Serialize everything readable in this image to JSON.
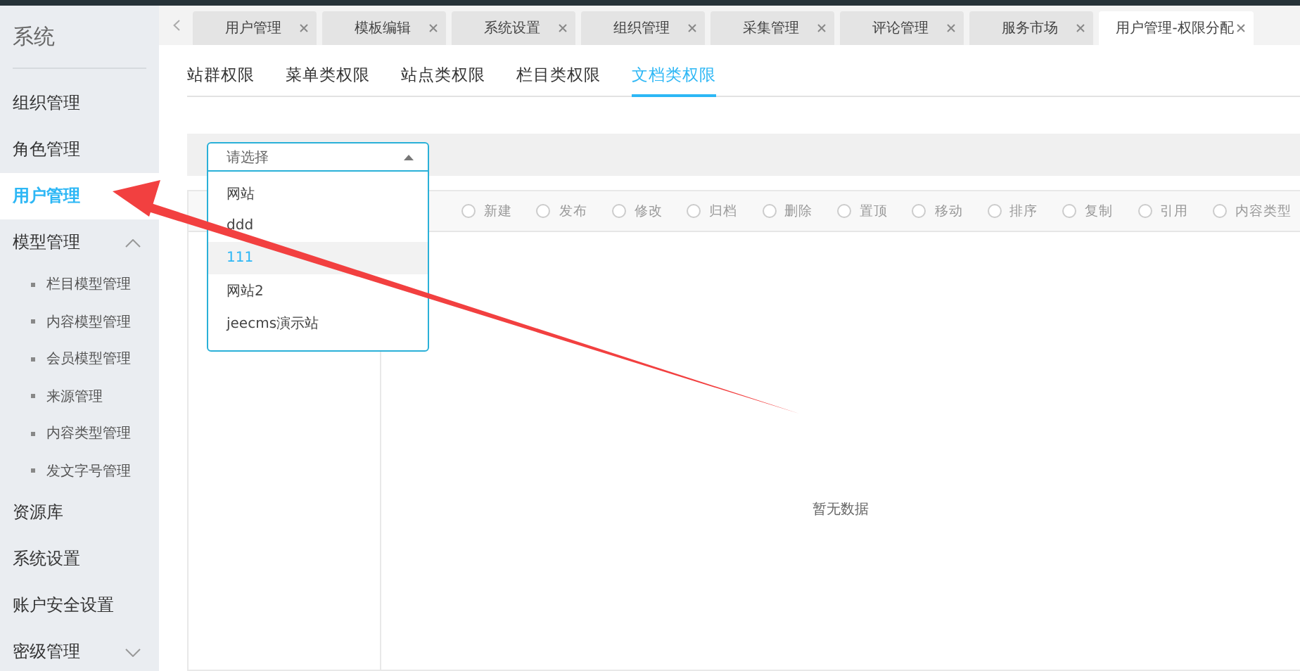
{
  "sidebar": {
    "title": "系统",
    "items": [
      {
        "label": "组织管理",
        "selected": false
      },
      {
        "label": "角色管理",
        "selected": false
      },
      {
        "label": "用户管理",
        "selected": true
      },
      {
        "label": "模型管理",
        "selected": false,
        "expanded": true,
        "children": [
          {
            "label": "栏目模型管理"
          },
          {
            "label": "内容模型管理"
          },
          {
            "label": "会员模型管理"
          },
          {
            "label": "来源管理"
          },
          {
            "label": "内容类型管理"
          },
          {
            "label": "发文字号管理"
          }
        ]
      },
      {
        "label": "资源库",
        "selected": false
      },
      {
        "label": "系统设置",
        "selected": false
      },
      {
        "label": "账户安全设置",
        "selected": false
      },
      {
        "label": "密级管理",
        "selected": false,
        "expanded": false
      }
    ]
  },
  "tabs": [
    {
      "label": "用户管理",
      "selected": false
    },
    {
      "label": "模板编辑",
      "selected": false
    },
    {
      "label": "系统设置",
      "selected": false
    },
    {
      "label": "组织管理",
      "selected": false
    },
    {
      "label": "采集管理",
      "selected": false
    },
    {
      "label": "评论管理",
      "selected": false
    },
    {
      "label": "服务市场",
      "selected": false
    },
    {
      "label": "用户管理-权限分配",
      "selected": true
    }
  ],
  "sub_tabs": [
    {
      "label": "站群权限",
      "selected": false
    },
    {
      "label": "菜单类权限",
      "selected": false
    },
    {
      "label": "站点类权限",
      "selected": false
    },
    {
      "label": "栏目类权限",
      "selected": false
    },
    {
      "label": "文档类权限",
      "selected": true
    }
  ],
  "site_select": {
    "placeholder": "请选择",
    "expanded": true,
    "options": [
      {
        "label": "网站",
        "selected": false
      },
      {
        "label": "ddd",
        "selected": false
      },
      {
        "label": "111",
        "selected": true
      },
      {
        "label": "网站2",
        "selected": false
      },
      {
        "label": "jeecms演示站",
        "selected": false
      }
    ]
  },
  "permissions": [
    {
      "label": "新建",
      "checked": false
    },
    {
      "label": "发布",
      "checked": false
    },
    {
      "label": "修改",
      "checked": false
    },
    {
      "label": "归档",
      "checked": false
    },
    {
      "label": "删除",
      "checked": false
    },
    {
      "label": "置顶",
      "checked": false
    },
    {
      "label": "移动",
      "checked": false
    },
    {
      "label": "排序",
      "checked": false
    },
    {
      "label": "复制",
      "checked": false
    },
    {
      "label": "引用",
      "checked": false
    },
    {
      "label": "内容类型",
      "checked": false
    }
  ],
  "empty_text": "暂无数据"
}
